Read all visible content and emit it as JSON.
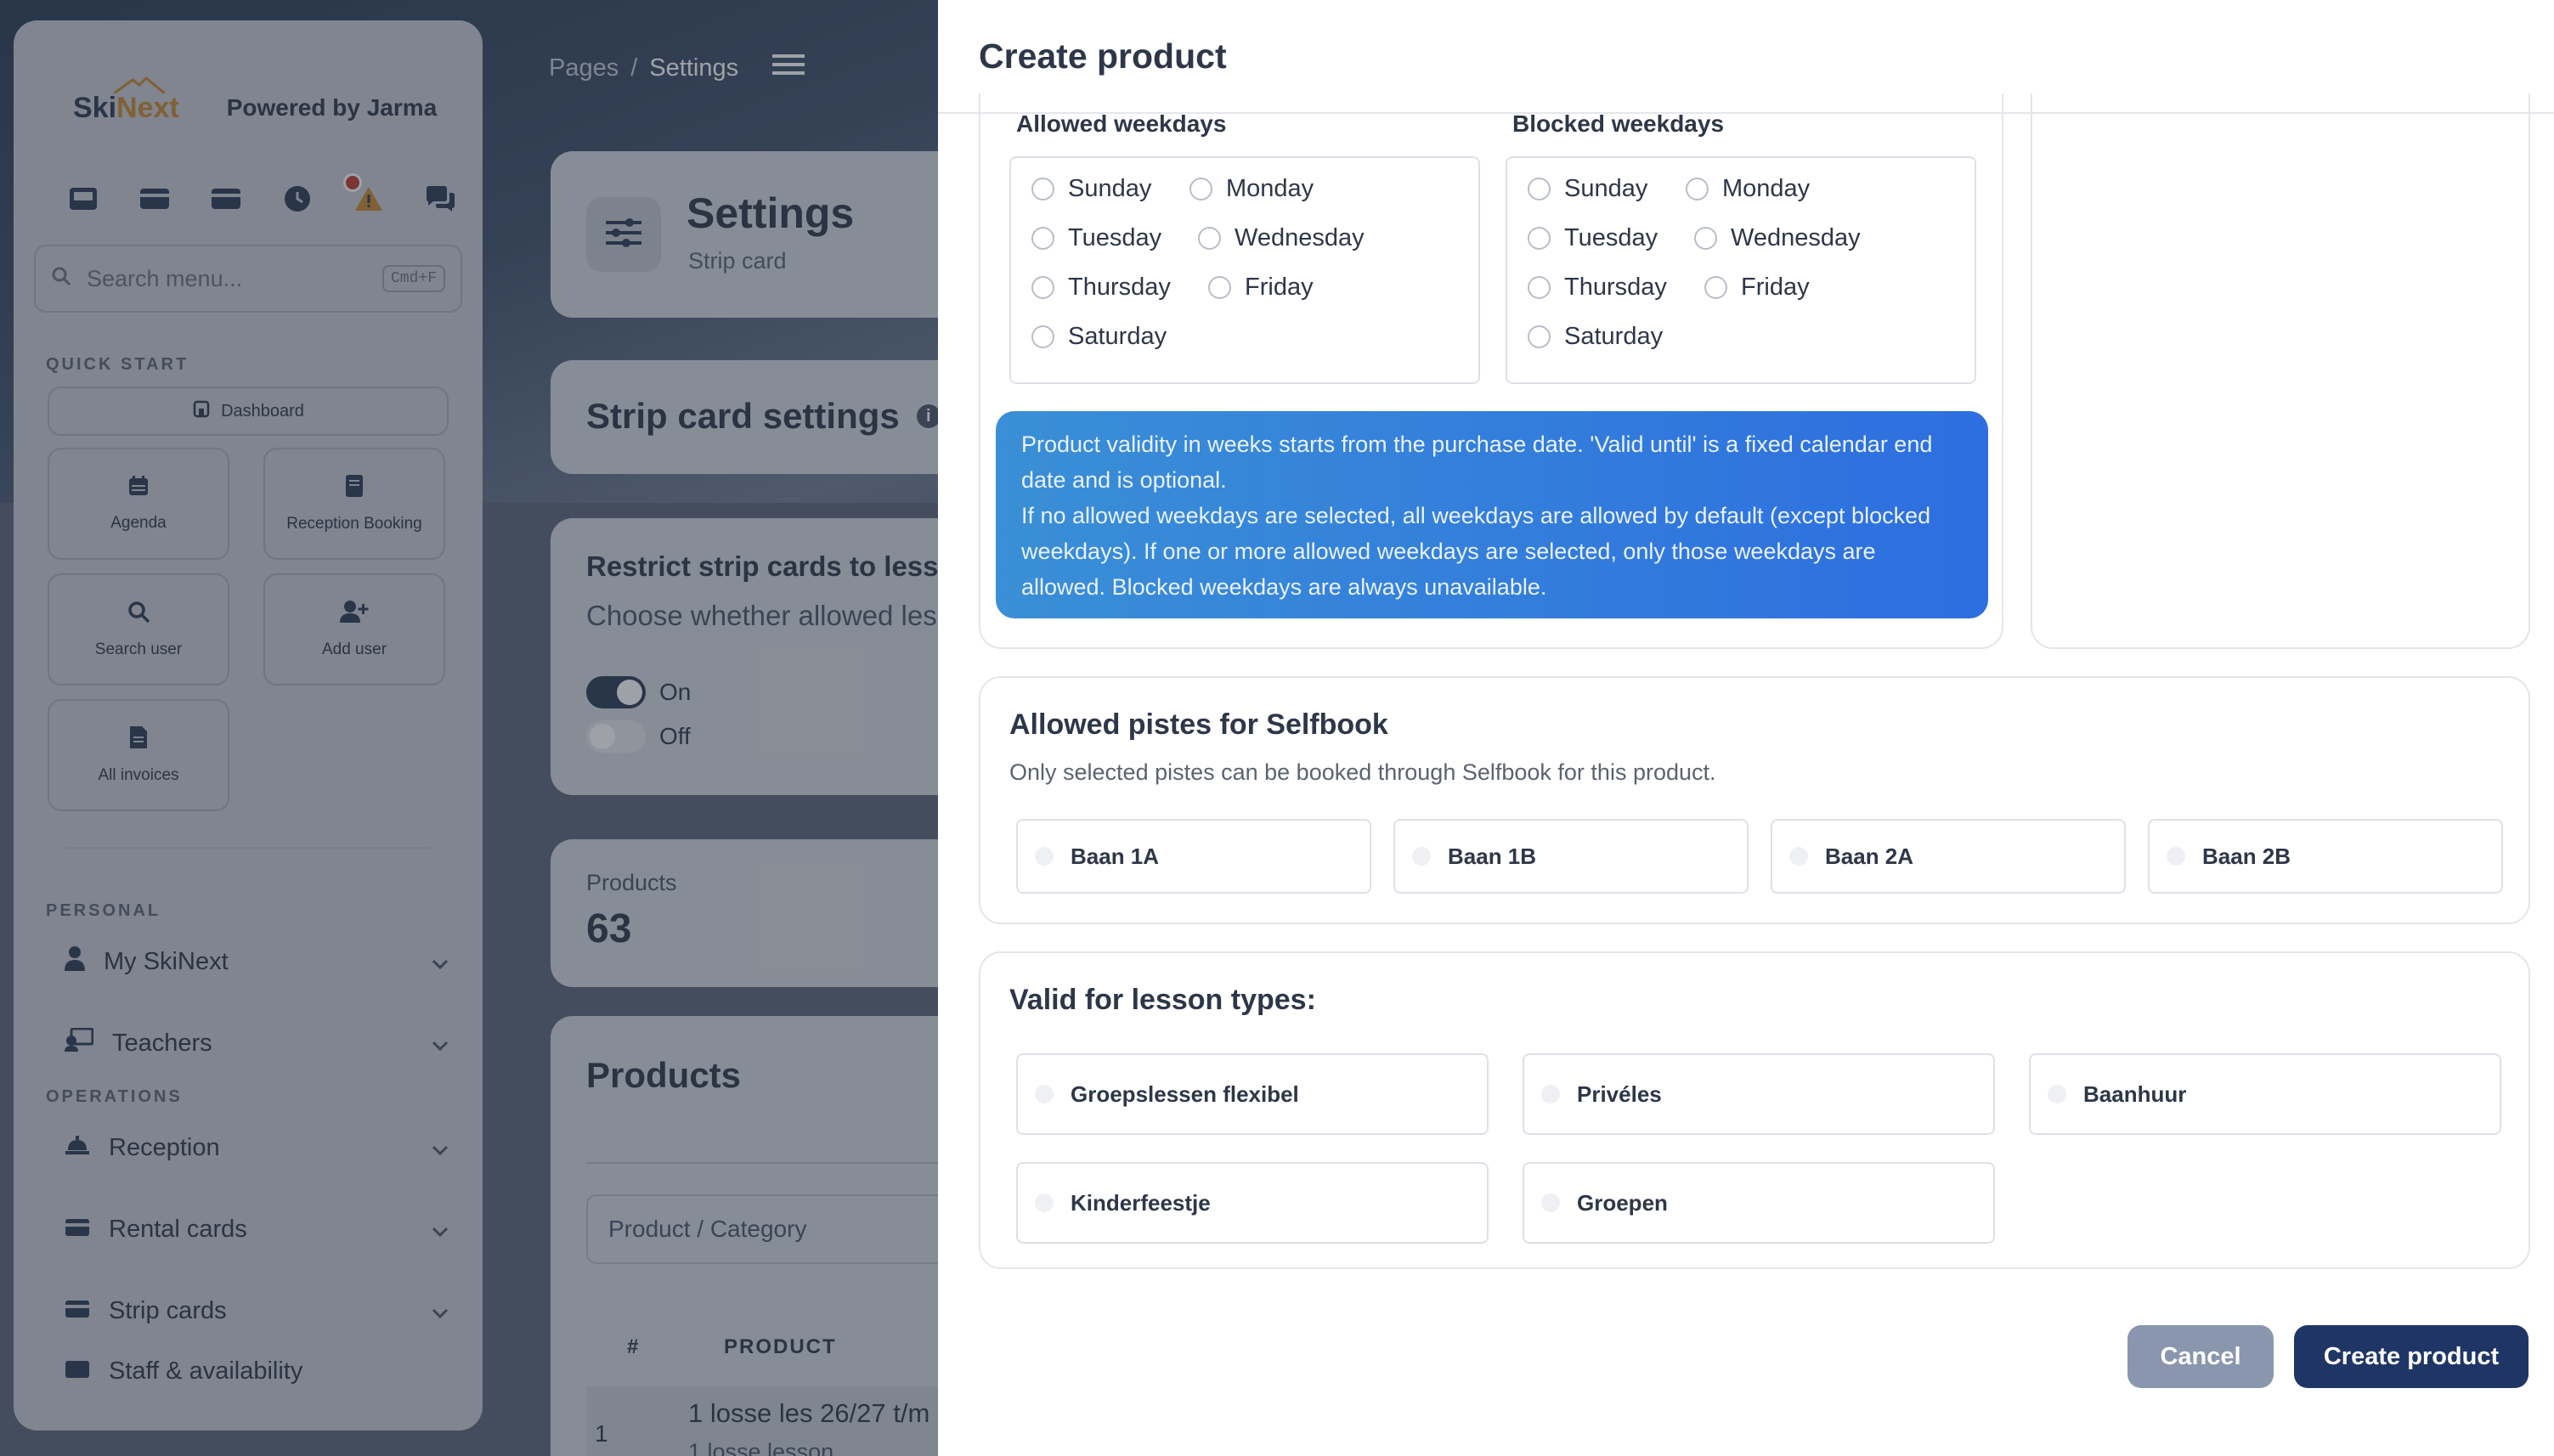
{
  "sidebar": {
    "logo": {
      "ski": "Ski",
      "next": "Next"
    },
    "powered_by": "Powered by Jarma",
    "search_placeholder": "Search menu...",
    "search_shortcut": "Cmd+F",
    "quick_start_label": "QUICK START",
    "dashboard_label": "Dashboard",
    "tiles": [
      {
        "label": "Agenda",
        "icon": "calendar-icon"
      },
      {
        "label": "Reception Booking",
        "icon": "book-icon"
      },
      {
        "label": "Search user",
        "icon": "search-icon"
      },
      {
        "label": "Add user",
        "icon": "add-user-icon"
      },
      {
        "label": "All invoices",
        "icon": "invoice-icon"
      }
    ],
    "personal_label": "PERSONAL",
    "operations_label": "OPERATIONS",
    "personal_items": [
      {
        "label": "My SkiNext",
        "icon": "person-icon"
      },
      {
        "label": "Teachers",
        "icon": "teacher-icon"
      }
    ],
    "operations_items": [
      {
        "label": "Reception",
        "icon": "reception-icon"
      },
      {
        "label": "Rental cards",
        "icon": "card-icon"
      },
      {
        "label": "Strip cards",
        "icon": "card-icon"
      },
      {
        "label": "Staff & availability",
        "icon": "staff-icon"
      }
    ]
  },
  "breadcrumb": {
    "root": "Pages",
    "separator": "/",
    "current": "Settings"
  },
  "page": {
    "title": "Settings",
    "subtitle": "Strip card",
    "strip_settings_title": "Strip card settings",
    "restrict_title": "Restrict strip cards to less",
    "restrict_sub": "Choose whether allowed les",
    "toggle_on": "On",
    "toggle_off": "Off",
    "products_stat_label": "Products",
    "products_stat_value": "63",
    "products_title": "Products",
    "filter_placeholder": "Product / Category",
    "table_headers": [
      "#",
      "PRODUCT"
    ],
    "table_row": {
      "num": "1",
      "name": "1 losse les 26/27 t/m",
      "sub": "1 losse lesson"
    }
  },
  "modal": {
    "title": "Create product",
    "allowed_weekdays_label": "Allowed weekdays",
    "blocked_weekdays_label": "Blocked weekdays",
    "days": [
      "Sunday",
      "Monday",
      "Tuesday",
      "Wednesday",
      "Thursday",
      "Friday",
      "Saturday"
    ],
    "info_text": "Product validity in weeks starts from the purchase date. 'Valid until' is a fixed calendar end date and is optional.\nIf no allowed weekdays are selected, all weekdays are allowed by default (except blocked weekdays). If one or more allowed weekdays are selected, only those weekdays are allowed. Blocked weekdays are always unavailable.",
    "pistes_title": "Allowed pistes for Selfbook",
    "pistes_sub": "Only selected pistes can be booked through Selfbook for this product.",
    "pistes": [
      "Baan 1A",
      "Baan 1B",
      "Baan 2A",
      "Baan 2B"
    ],
    "lessons_title": "Valid for lesson types:",
    "lesson_types": [
      "Groepslessen flexibel",
      "Privéles",
      "Baanhuur",
      "Kinderfeestje",
      "Groepen"
    ],
    "cancel_label": "Cancel",
    "create_label": "Create product"
  },
  "colors": {
    "primary": "#1f3566",
    "cancel": "#8996ad",
    "info_from": "#3a8fd6",
    "info_to": "#2d6ee0",
    "toggle_on": "#2b3a52"
  }
}
